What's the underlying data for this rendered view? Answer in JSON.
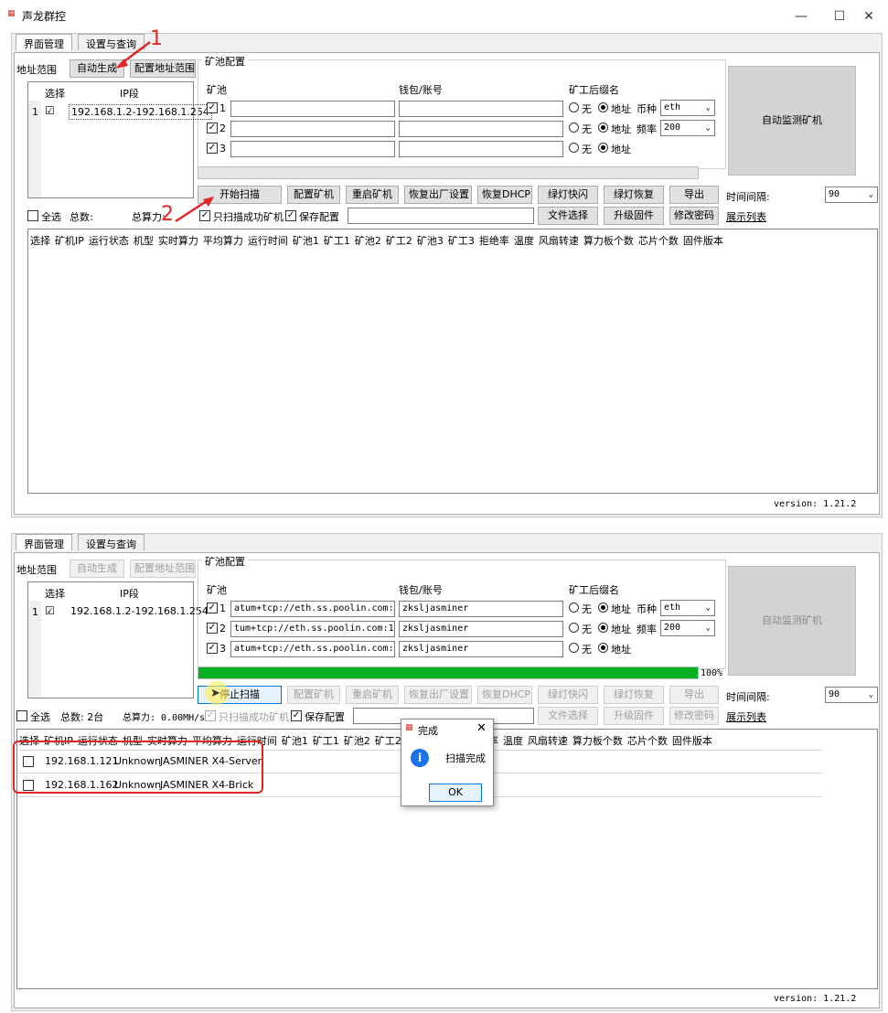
{
  "window": {
    "title": "声龙群控",
    "icon": "app-icon",
    "minimize": "—",
    "maximize": "☐",
    "close": "✕"
  },
  "annotations": {
    "step1": "1",
    "step2": "2"
  },
  "shot1": {
    "tabs": [
      "界面管理",
      "设置与查询"
    ],
    "addr_label": "地址范围",
    "auto_btn": "自动生成",
    "config_addr_btn": "配置地址范围",
    "ip_headers": {
      "select": "选择",
      "ip": "IP段"
    },
    "ip_rows": [
      {
        "idx": "1",
        "checked": "☑",
        "ip": "192.168.1.2-192.168.1.254"
      }
    ],
    "pool_group": "矿池配置",
    "pool_header": "矿池",
    "wallet_header": "钱包/账号",
    "suffix_header": "矿工后缀名",
    "pools": [
      {
        "num": "1",
        "url": "",
        "wallet": ""
      },
      {
        "num": "2",
        "url": "",
        "wallet": ""
      },
      {
        "num": "3",
        "url": "",
        "wallet": ""
      }
    ],
    "none_label": "无",
    "addr_radio": "地址",
    "coin_label": "币种",
    "coin_value": "eth",
    "freq_label": "频率",
    "freq_value": "200",
    "monitor_btn": "自动监测矿机",
    "progress": 0,
    "progress_text": "",
    "buttons": [
      "开始扫描",
      "配置矿机",
      "重启矿机",
      "恢复出厂设置",
      "恢复DHCP",
      "绿灯快闪",
      "绿灯恢复",
      "导出"
    ],
    "interval_label": "时间间隔:",
    "interval_value": "90",
    "select_all": "全选",
    "total_label": "总数:",
    "hashrate_label": "总算力:",
    "only_success": "只扫描成功矿机",
    "save_config": "保存配置",
    "file_select": "文件选择",
    "upgrade": "升级固件",
    "change_pwd": "修改密码",
    "show_list": "展示列表",
    "columns": [
      "选择",
      "矿机IP",
      "运行状态",
      "机型",
      "实时算力",
      "平均算力",
      "运行时间",
      "矿池1",
      "矿工1",
      "矿池2",
      "矿工2",
      "矿池3",
      "矿工3",
      "拒绝率",
      "温度",
      "风扇转速",
      "算力板个数",
      "芯片个数",
      "固件版本"
    ],
    "version": "version: 1.21.2"
  },
  "shot2": {
    "tabs": [
      "界面管理",
      "设置与查询"
    ],
    "addr_label": "地址范围",
    "auto_btn": "自动生成",
    "config_addr_btn": "配置地址范围",
    "ip_headers": {
      "select": "选择",
      "ip": "IP段"
    },
    "ip_rows": [
      {
        "idx": "1",
        "checked": "☑",
        "ip": "192.168.1.2-192.168.1.254"
      }
    ],
    "pool_group": "矿池配置",
    "pool_header": "矿池",
    "wallet_header": "钱包/账号",
    "suffix_header": "矿工后缀名",
    "pools": [
      {
        "num": "1",
        "url": "atum+tcp://eth.ss.poolin.com:443",
        "wallet": "zksljasminer"
      },
      {
        "num": "2",
        "url": "tum+tcp://eth.ss.poolin.com:1883",
        "wallet": "zksljasminer"
      },
      {
        "num": "3",
        "url": "atum+tcp://eth.ss.poolin.com:700",
        "wallet": "zksljasminer"
      }
    ],
    "none_label": "无",
    "addr_radio": "地址",
    "coin_label": "币种",
    "coin_value": "eth",
    "freq_label": "频率",
    "freq_value": "200",
    "monitor_btn": "自动监测矿机",
    "progress": 100,
    "progress_text": "100%",
    "buttons": [
      "停止扫描",
      "配置矿机",
      "重启矿机",
      "恢复出厂设置",
      "恢复DHCP",
      "绿灯快闪",
      "绿灯恢复",
      "导出"
    ],
    "interval_label": "时间间隔:",
    "interval_value": "90",
    "select_all": "全选",
    "total_label": "总数: 2台",
    "hashrate_label": "总算力: 0.00MH/s",
    "only_success": "只扫描成功矿机",
    "save_config": "保存配置",
    "file_select": "文件选择",
    "upgrade": "升级固件",
    "change_pwd": "修改密码",
    "show_list": "展示列表",
    "columns": [
      "选择",
      "矿机IP",
      "运行状态",
      "机型",
      "实时算力",
      "平均算力",
      "运行时间",
      "矿池1",
      "矿工1",
      "矿池2",
      "矿工2",
      "矿池3",
      "矿工3",
      "拒绝率",
      "温度",
      "风扇转速",
      "算力板个数",
      "芯片个数",
      "固件版本"
    ],
    "rows": [
      {
        "ip": "192.168.1.121",
        "status": "Unknown",
        "model": "JASMINER X4-Server"
      },
      {
        "ip": "192.168.1.162",
        "status": "Unknown",
        "model": "JASMINER X4-Brick"
      }
    ],
    "version": "version: 1.21.2",
    "dialog": {
      "title": "完成",
      "message": "扫描完成",
      "ok": "OK",
      "close": "✕",
      "icon": "info-icon",
      "icon_glyph": "i"
    }
  }
}
